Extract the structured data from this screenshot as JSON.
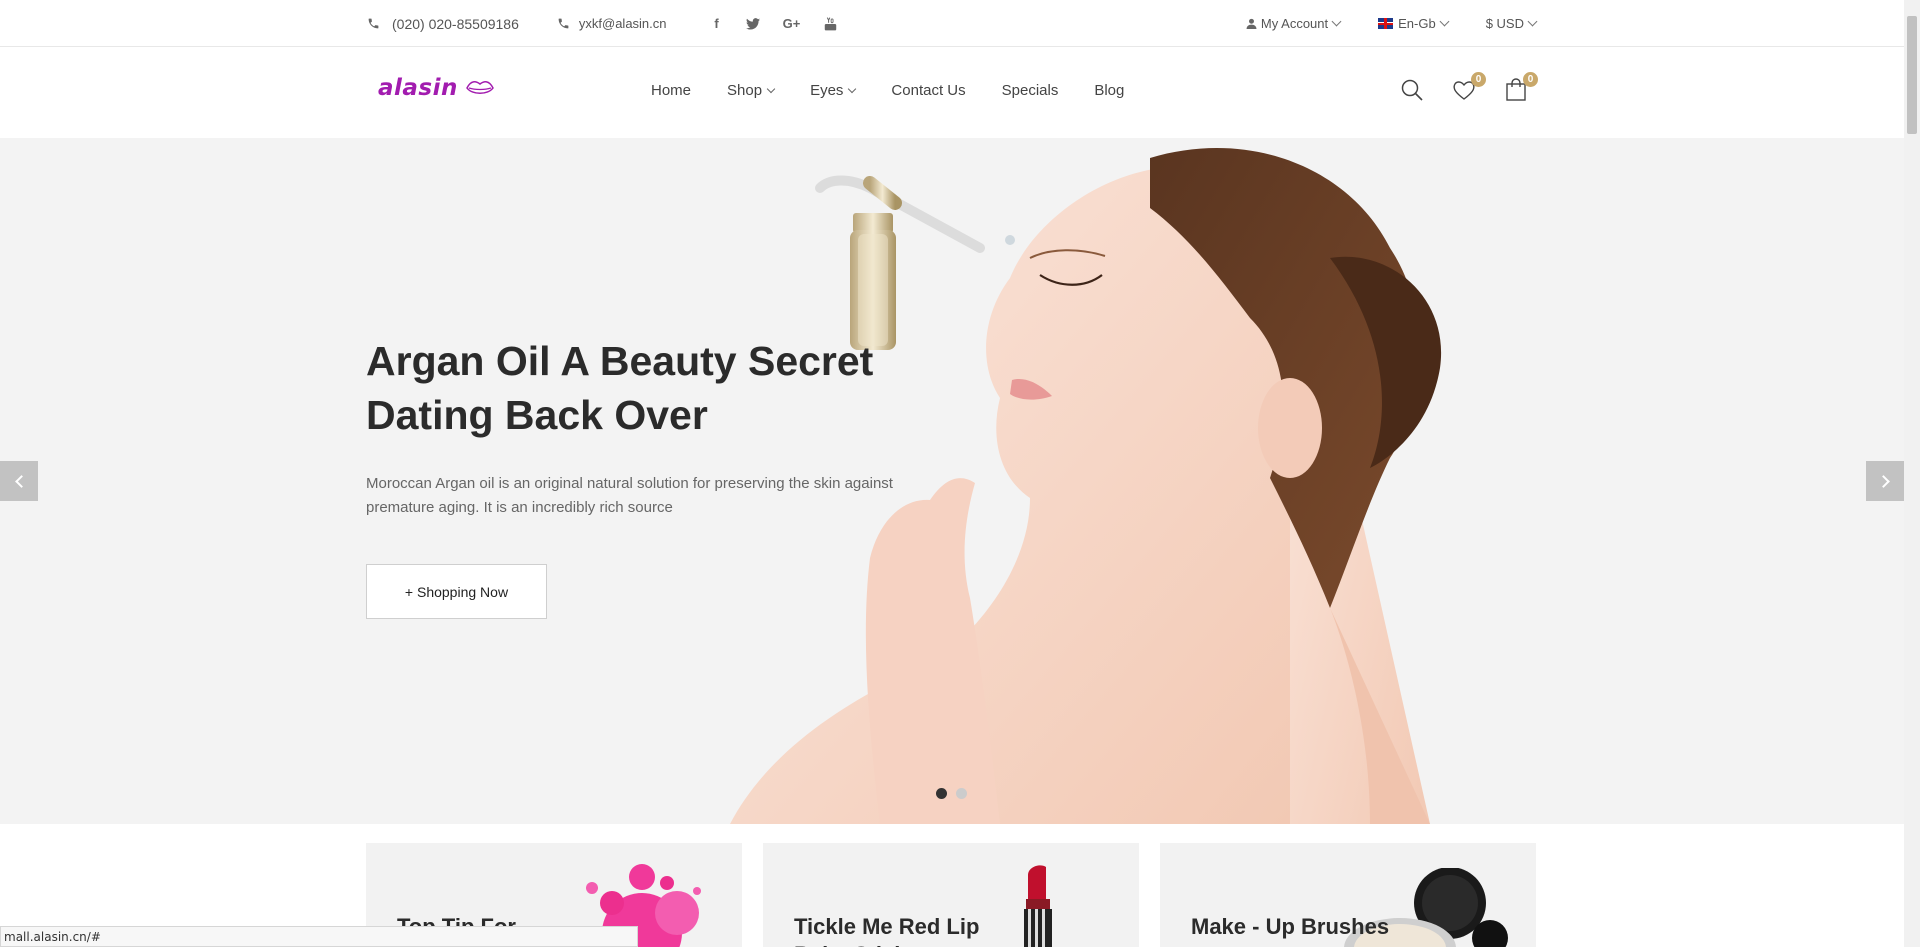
{
  "topbar": {
    "phone": "(020)  020-85509186",
    "email": "yxkf@alasin.cn",
    "social": [
      "facebook-icon",
      "twitter-icon",
      "google-plus-icon",
      "youtube-icon"
    ],
    "account": "My Account",
    "language": "En-Gb",
    "currency": "$ USD"
  },
  "header": {
    "logo_text": "alasin",
    "nav": [
      "Home",
      "Shop",
      "Eyes",
      "Contact Us",
      "Specials",
      "Blog"
    ],
    "wishlist_count": "0",
    "cart_count": "0"
  },
  "hero": {
    "title": "Argan Oil A Beauty Secret Dating Back Over",
    "description": "Moroccan Argan oil is an original natural solution for preserving the skin against premature aging. It is an incredibly rich source",
    "button": "+ Shopping Now",
    "slides_total": 2,
    "active_slide": 1
  },
  "banners": [
    {
      "title": "Top Tip For ..."
    },
    {
      "title": "Tickle Me Red Lip Balm Stick"
    },
    {
      "title": "Make - Up Brushes"
    }
  ],
  "status_url": "mall.alasin.cn/#",
  "colors": {
    "accent": "#c9a86a",
    "logo": "#a21caf"
  }
}
